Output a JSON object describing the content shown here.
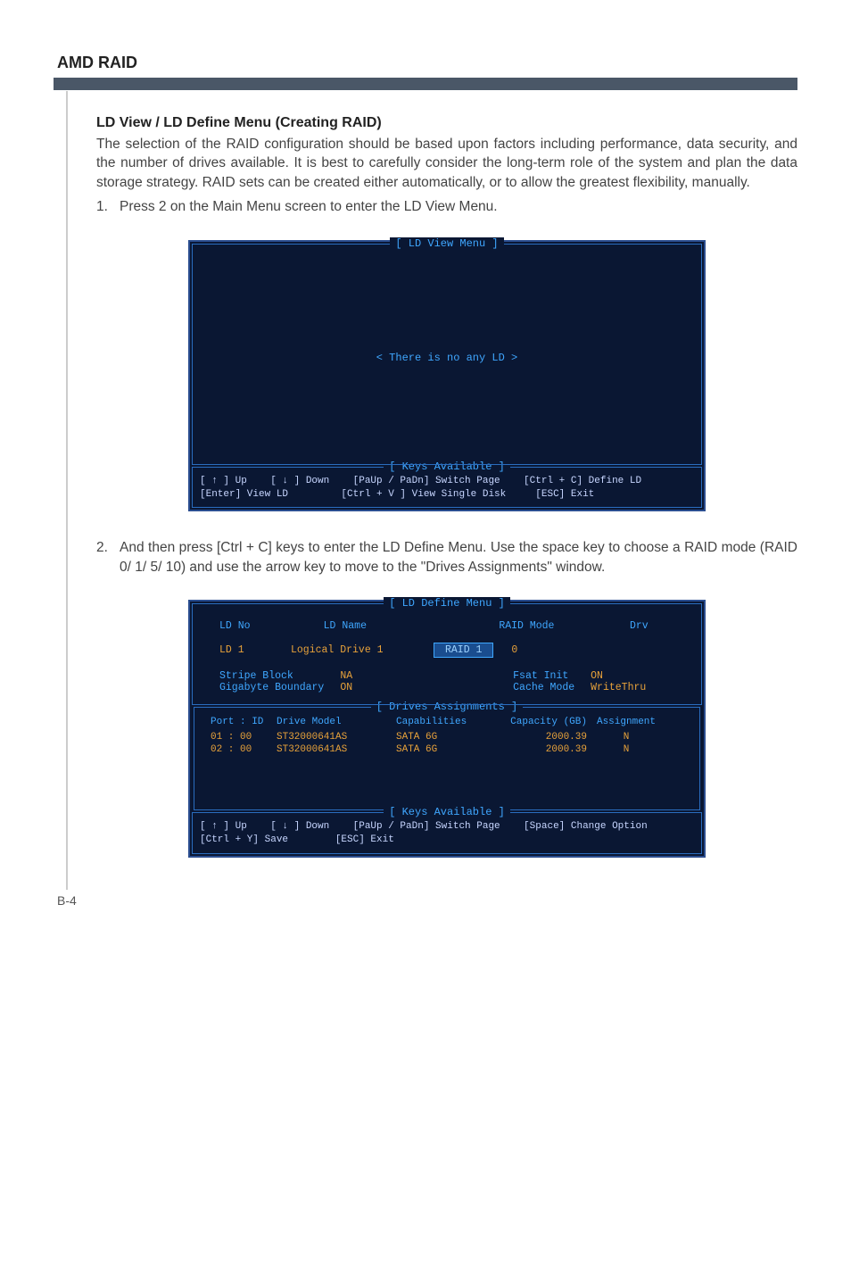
{
  "header": {
    "title": "AMD RAID"
  },
  "section": {
    "title": "LD View / LD Define Menu (Creating RAID)",
    "intro": "The selection of the RAID configuration should be based upon factors including performance, data security, and the number of drives available. It is best to carefully consider the long-term role of the system and plan the data storage strategy. RAID sets can be created either automatically, or to allow the greatest flexibility, manually.",
    "step1_num": "1.",
    "step1_text": "Press 2 on the Main Menu screen to enter the LD View Menu.",
    "step2_num": "2.",
    "step2_text": "And then press [Ctrl + C] keys to enter the LD Define Menu. Use the space key to choose a RAID mode (RAID 0/ 1/ 5/ 10) and use the arrow key to move to the \"Drives Assignments\" window."
  },
  "bios1": {
    "title": "[  LD View Menu  ]",
    "message": "<  There is no any LD  >",
    "keys_title": "[ Keys Available ]",
    "line1": "[ ↑ ] Up    [ ↓ ] Down    [PaUp / PaDn] Switch Page    [Ctrl + C] Define LD",
    "line2": "[Enter] View LD         [Ctrl + V ] View Single Disk     [ESC] Exit"
  },
  "bios2": {
    "title": "[  LD Define Menu  ]",
    "ldno_label": "LD No",
    "ldname_label": "LD Name",
    "raidmode_label": "RAID Mode",
    "drv_label": "Drv",
    "ld_num": "LD   1",
    "ld_name": "Logical Drive 1",
    "raid_sel": "RAID 1",
    "drv_val": "0",
    "stripe_label": "Stripe Block",
    "stripe_val": "NA",
    "gig_label": "Gigabyte Boundary",
    "gig_val": "ON",
    "fsat_label": "Fsat Init",
    "fsat_val": "ON",
    "cache_label": "Cache Mode",
    "cache_val": "WriteThru",
    "drives_title": "[  Drives Assignments  ]",
    "dh": {
      "port": "Port  : ID",
      "model": "Drive Model",
      "cap": "Capabilities",
      "capgb": "Capacity (GB)",
      "asg": "Assignment"
    },
    "rows": [
      {
        "port": "01 : 00",
        "model": "ST32000641AS",
        "cap": "SATA 6G",
        "capgb": "2000.39",
        "asg": "N"
      },
      {
        "port": "02 : 00",
        "model": "ST32000641AS",
        "cap": "SATA 6G",
        "capgb": "2000.39",
        "asg": "N"
      }
    ],
    "keys_title": "[ Keys Available ]",
    "line1": "[ ↑ ] Up    [ ↓ ] Down    [PaUp / PaDn] Switch Page    [Space] Change Option",
    "line2": "[Ctrl + Y] Save        [ESC] Exit"
  },
  "footer": {
    "page": "B-4"
  }
}
